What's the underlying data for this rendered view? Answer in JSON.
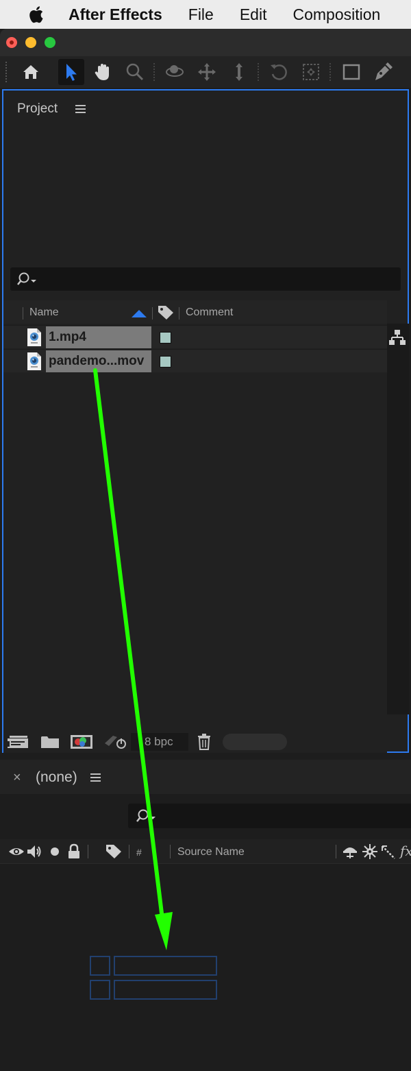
{
  "menubar": {
    "app_name": "After Effects",
    "items": [
      "File",
      "Edit",
      "Composition"
    ]
  },
  "toolbar": {
    "tools": [
      "home-icon",
      "selection-tool-icon",
      "hand-tool-icon",
      "zoom-tool-icon",
      "orbit-camera-icon",
      "pan-camera-icon",
      "dolly-camera-icon",
      "rotation-tool-icon",
      "pan-behind-icon",
      "rectangle-tool-icon",
      "pen-tool-icon"
    ],
    "active_tool": "selection-tool-icon",
    "accent_color": "#2d7bf0"
  },
  "project_panel": {
    "title": "Project",
    "search": {
      "value": "",
      "placeholder": ""
    },
    "columns": {
      "name": "Name",
      "comment": "Comment"
    },
    "items": [
      {
        "name": "1.mp4",
        "label_color": "#a6c8c2"
      },
      {
        "name": "pandemo...mov",
        "label_color": "#a6c8c2"
      }
    ],
    "bottom_bar": {
      "bit_depth": "8 bpc"
    }
  },
  "timeline_panel": {
    "title": "(none)",
    "close_glyph": "×",
    "search": {
      "value": "",
      "placeholder": ""
    },
    "columns": {
      "number": "#",
      "source_name": "Source Name",
      "fx": "fx"
    }
  },
  "annotation": {
    "arrow_color": "#22ff00"
  }
}
